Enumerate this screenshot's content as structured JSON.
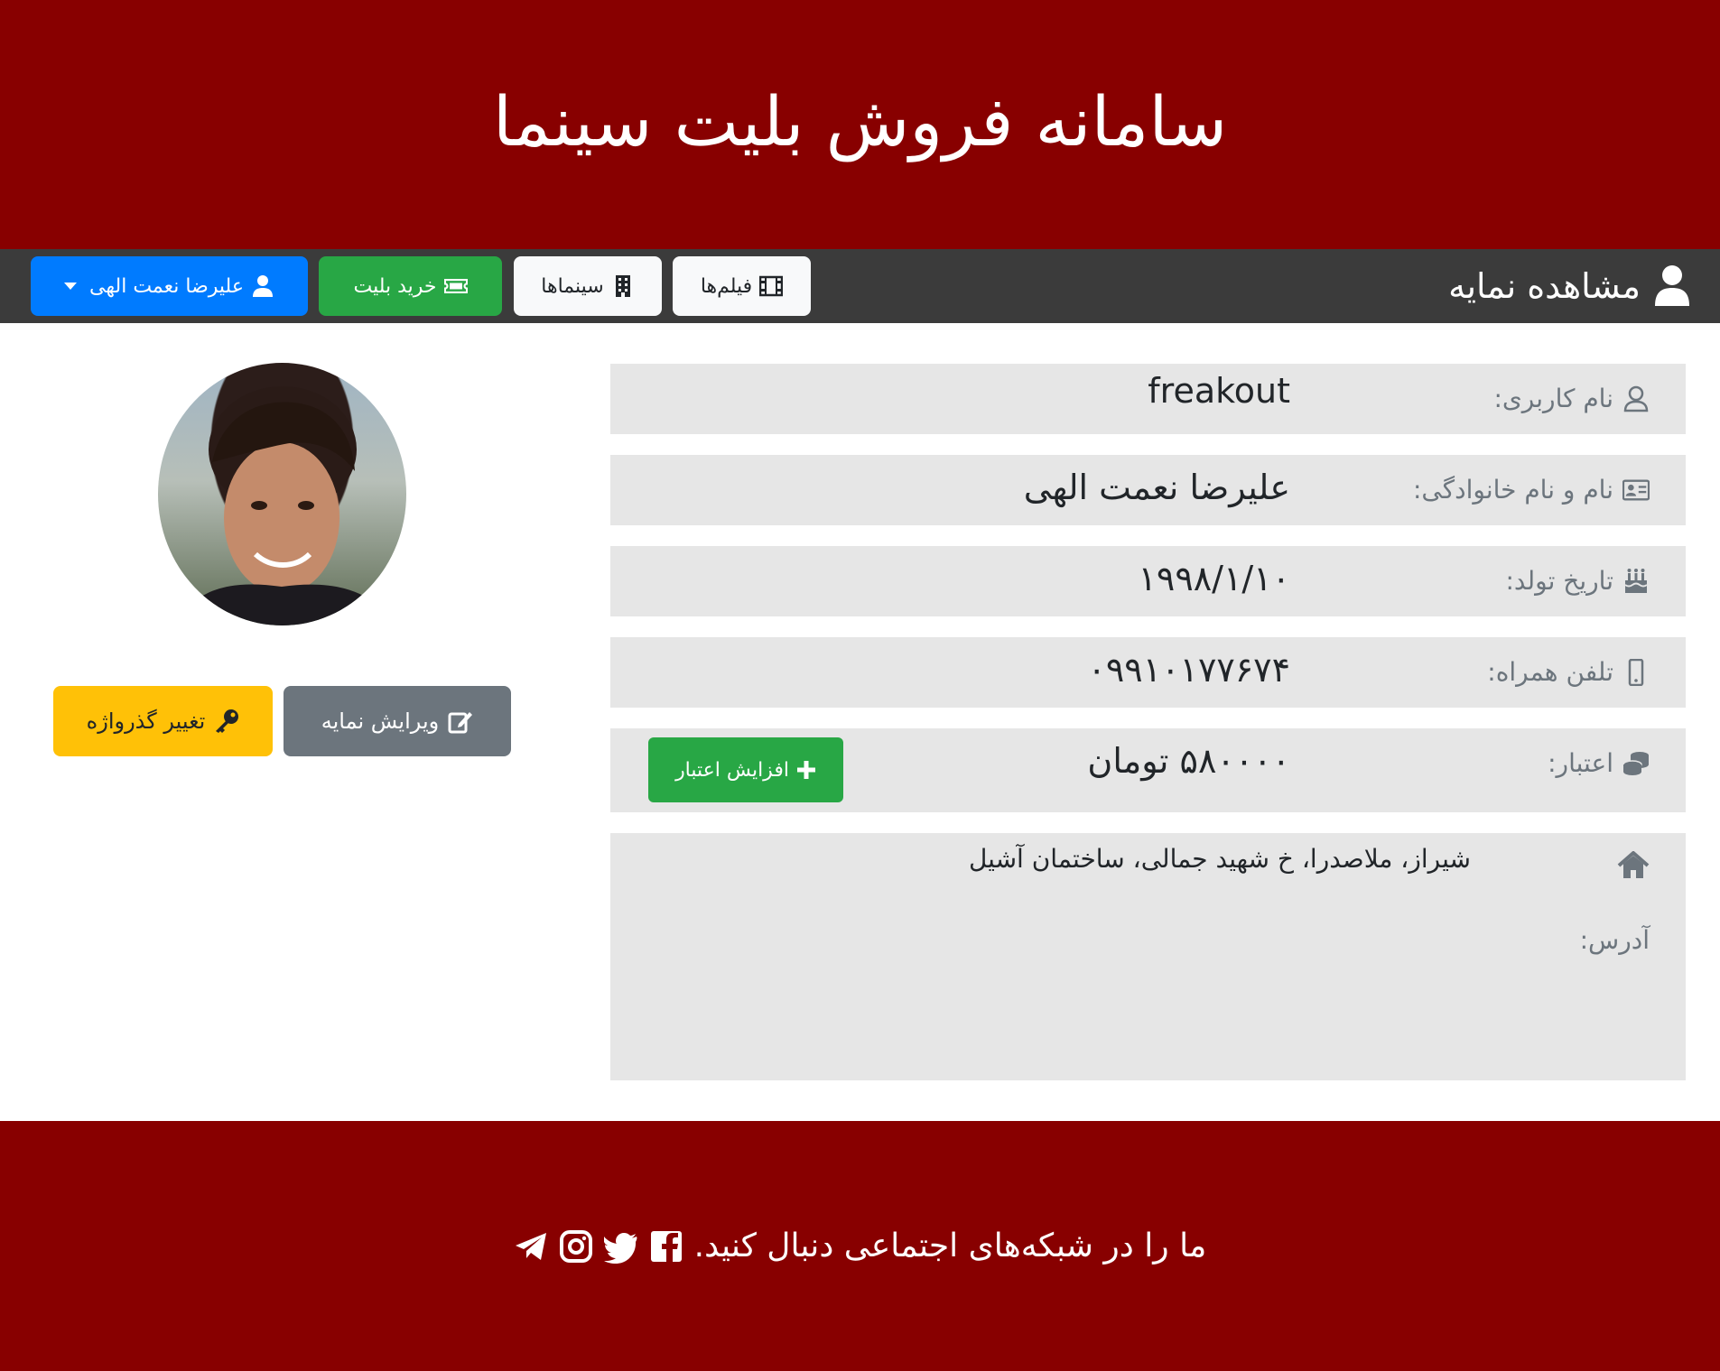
{
  "header": {
    "title": "سامانه فروش بلیت سینما"
  },
  "navbar": {
    "brand": "مشاهده نمایه",
    "buttons": {
      "films": "فیلم‌ها",
      "cinemas": "سینماها",
      "buy_ticket": "خرید بلیت",
      "user": "علیرضا نعمت الهی"
    }
  },
  "profile": {
    "edit_button": "ویرایش نمایه",
    "change_password_button": "تغییر گذرواژه"
  },
  "info": {
    "username": {
      "label": "نام کاربری:",
      "value": "freakout"
    },
    "fullname": {
      "label": "نام و نام خانوادگی:",
      "value": "علیرضا نعمت الهی"
    },
    "birthdate": {
      "label": "تاریخ تولد:",
      "value": "۱۹۹۸/۱/۱۰"
    },
    "mobile": {
      "label": "تلفن همراه:",
      "value": "۰۹۹۱۰۱۷۷۶۷۴"
    },
    "credit": {
      "label": "اعتبار:",
      "value": "۵۸۰۰۰۰ تومان",
      "button": "افزایش اعتبار"
    },
    "address": {
      "label": "آدرس:",
      "value": "شیراز، ملاصدرا، خ شهید جمالی، ساختمان آشیل"
    }
  },
  "footer": {
    "text": "ما را در شبکه‌های اجتماعی دنبال کنید."
  },
  "colors": {
    "header_bg": "#880000",
    "navbar_bg": "#3b3b3b",
    "info_bg": "#e6e6e6",
    "green": "#28a745",
    "blue": "#007bff",
    "gray": "#6c757d",
    "yellow": "#ffc107"
  },
  "icons": [
    "user-icon",
    "film-icon",
    "building-icon",
    "ticket-icon",
    "edit-icon",
    "key-icon",
    "id-card-icon",
    "birthday-cake-icon",
    "mobile-icon",
    "coins-icon",
    "home-icon",
    "plus-icon",
    "facebook-icon",
    "twitter-icon",
    "instagram-icon",
    "telegram-icon"
  ]
}
